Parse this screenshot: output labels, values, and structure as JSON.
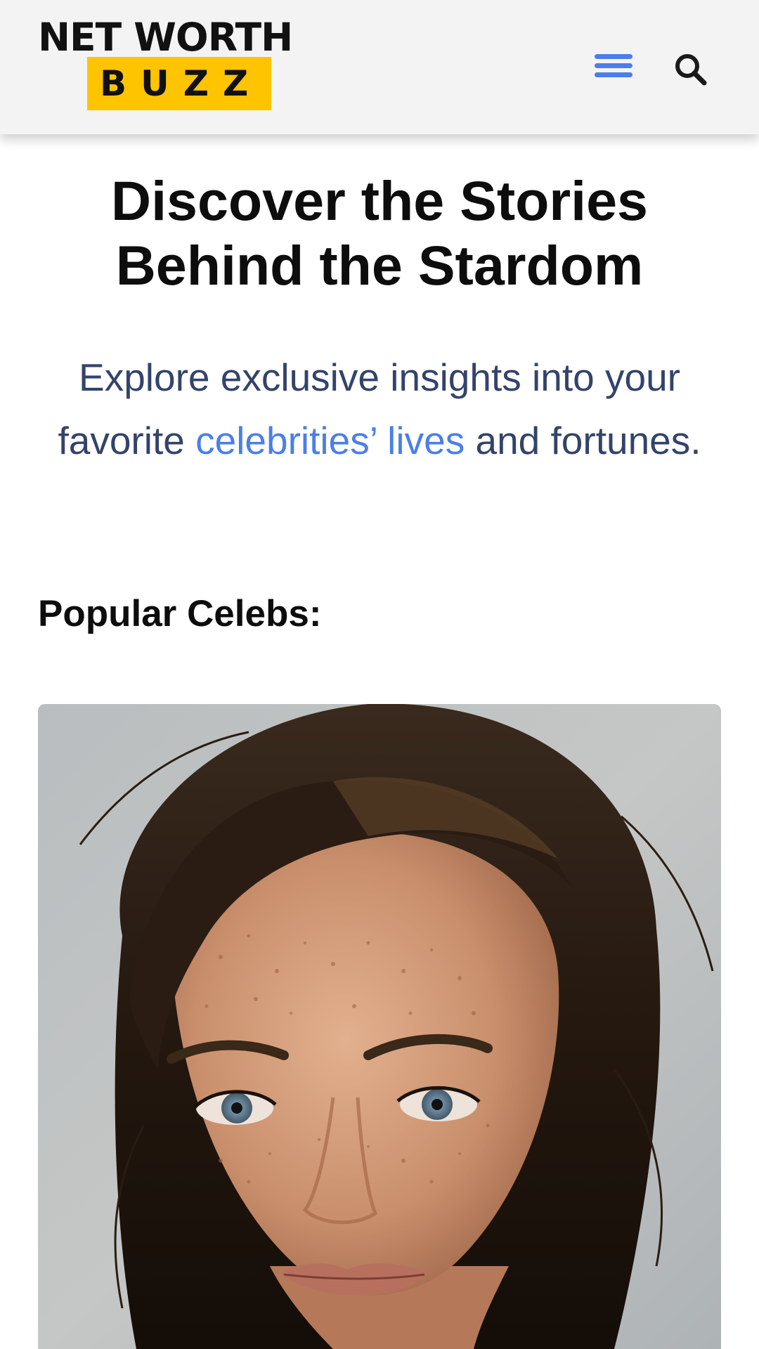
{
  "header": {
    "logo": {
      "line1": "NET WORTH",
      "line2": "BUZZ"
    },
    "menu_icon": "hamburger-menu-icon",
    "search_icon": "search-icon"
  },
  "hero": {
    "title_line1": "Discover the Stories",
    "title_line2": "Behind the Stardom",
    "subtitle_before": "Explore exclusive insights into your favorite ",
    "subtitle_link": "celebrities’ lives",
    "subtitle_after": " and fortunes."
  },
  "popular": {
    "heading": "Popular Celebs:"
  },
  "colors": {
    "accent_blue": "#4a7fe8",
    "logo_yellow": "#ffc400",
    "subtitle_navy": "#33436a",
    "header_bg": "#f3f3f3"
  }
}
